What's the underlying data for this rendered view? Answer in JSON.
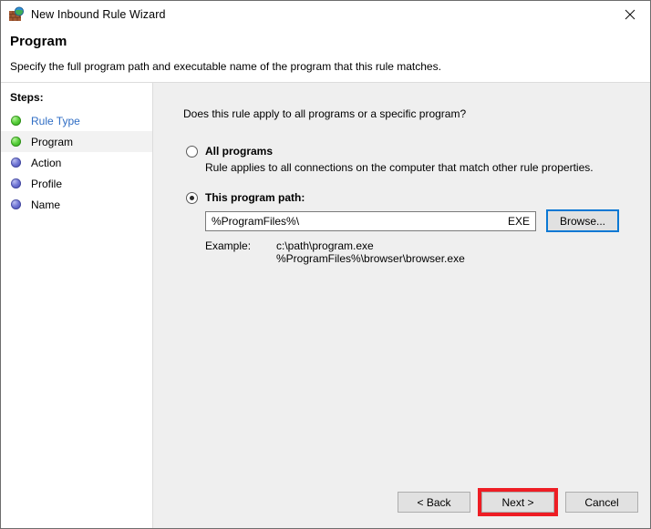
{
  "window": {
    "title": "New Inbound Rule Wizard",
    "icon": "firewall-globe-icon",
    "close_label": "✕"
  },
  "header": {
    "title": "Program",
    "subtitle": "Specify the full program path and executable name of the program that this rule matches."
  },
  "sidebar": {
    "heading": "Steps:",
    "items": [
      {
        "label": "Rule Type",
        "state": "done",
        "style": "link",
        "current": false
      },
      {
        "label": "Program",
        "state": "done",
        "style": "normal",
        "current": true
      },
      {
        "label": "Action",
        "state": "pending",
        "style": "normal",
        "current": false
      },
      {
        "label": "Profile",
        "state": "pending",
        "style": "normal",
        "current": false
      },
      {
        "label": "Name",
        "state": "pending",
        "style": "normal",
        "current": false
      }
    ]
  },
  "main": {
    "question": "Does this rule apply to all programs or a specific program?",
    "options": [
      {
        "id": "all-programs",
        "title": "All programs",
        "description": "Rule applies to all connections on the computer that match other rule properties.",
        "selected": false
      },
      {
        "id": "this-program-path",
        "title": "This program path:",
        "selected": true
      }
    ],
    "path_field": {
      "value": "%ProgramFiles%\\",
      "suffix": "EXE",
      "placeholder": "%ProgramFiles%\\"
    },
    "browse_label": "Browse...",
    "example": {
      "label": "Example:",
      "lines": [
        "c:\\path\\program.exe",
        "%ProgramFiles%\\browser\\browser.exe"
      ]
    }
  },
  "footer": {
    "back_label": "< Back",
    "next_label": "Next >",
    "cancel_label": "Cancel"
  },
  "colors": {
    "link": "#2f6dc4",
    "focus_border": "#0a78d4",
    "highlight_annotation": "#ee1d24",
    "step_done": "#56cf3a",
    "step_pending": "#6f75d4",
    "panel_background": "#efefef"
  }
}
